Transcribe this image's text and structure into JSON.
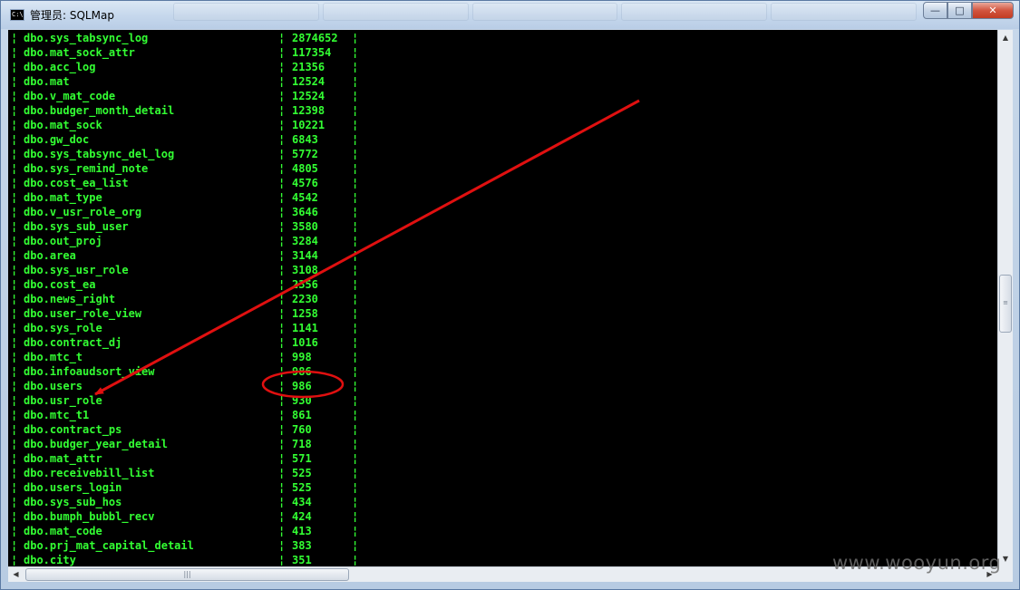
{
  "window": {
    "title": "管理员: SQLMap",
    "icon_label": "C:\\",
    "minimize_glyph": "—",
    "maximize_glyph": "□",
    "close_glyph": "✕"
  },
  "console": {
    "text_color": "#33ff33",
    "background": "#000000",
    "separator": "¦",
    "rows": [
      {
        "name": "dbo.sys_tabsync_log",
        "count": "2874652"
      },
      {
        "name": "dbo.mat_sock_attr",
        "count": "117354"
      },
      {
        "name": "dbo.acc_log",
        "count": "21356"
      },
      {
        "name": "dbo.mat",
        "count": "12524"
      },
      {
        "name": "dbo.v_mat_code",
        "count": "12524"
      },
      {
        "name": "dbo.budger_month_detail",
        "count": "12398"
      },
      {
        "name": "dbo.mat_sock",
        "count": "10221"
      },
      {
        "name": "dbo.gw_doc",
        "count": "6843"
      },
      {
        "name": "dbo.sys_tabsync_del_log",
        "count": "5772"
      },
      {
        "name": "dbo.sys_remind_note",
        "count": "4805"
      },
      {
        "name": "dbo.cost_ea_list",
        "count": "4576"
      },
      {
        "name": "dbo.mat_type",
        "count": "4542"
      },
      {
        "name": "dbo.v_usr_role_org",
        "count": "3646"
      },
      {
        "name": "dbo.sys_sub_user",
        "count": "3580"
      },
      {
        "name": "dbo.out_proj",
        "count": "3284"
      },
      {
        "name": "dbo.area",
        "count": "3144"
      },
      {
        "name": "dbo.sys_usr_role",
        "count": "3108"
      },
      {
        "name": "dbo.cost_ea",
        "count": "2356"
      },
      {
        "name": "dbo.news_right",
        "count": "2230"
      },
      {
        "name": "dbo.user_role_view",
        "count": "1258"
      },
      {
        "name": "dbo.sys_role",
        "count": "1141"
      },
      {
        "name": "dbo.contract_dj",
        "count": "1016"
      },
      {
        "name": "dbo.mtc_t",
        "count": "998"
      },
      {
        "name": "dbo.infoaudsort_view",
        "count": "986"
      },
      {
        "name": "dbo.users",
        "count": "986"
      },
      {
        "name": "dbo.usr_role",
        "count": "930"
      },
      {
        "name": "dbo.mtc_t1",
        "count": "861"
      },
      {
        "name": "dbo.contract_ps",
        "count": "760"
      },
      {
        "name": "dbo.budger_year_detail",
        "count": "718"
      },
      {
        "name": "dbo.mat_attr",
        "count": "571"
      },
      {
        "name": "dbo.receivebill_list",
        "count": "525"
      },
      {
        "name": "dbo.users_login",
        "count": "525"
      },
      {
        "name": "dbo.sys_sub_hos",
        "count": "434"
      },
      {
        "name": "dbo.bumph_bubbl_recv",
        "count": "424"
      },
      {
        "name": "dbo.mat_code",
        "count": "413"
      },
      {
        "name": "dbo.prj_mat_capital_detail",
        "count": "383"
      },
      {
        "name": "dbo.city",
        "count": "351"
      }
    ]
  },
  "annotation": {
    "color": "#e01010",
    "highlighted_row": "dbo.users"
  },
  "scrollbars": {
    "up_glyph": "▲",
    "down_glyph": "▼",
    "left_glyph": "◀",
    "right_glyph": "▶",
    "grip_glyph": "≡",
    "grip_glyph_h": "|||"
  },
  "watermark": "www.wooyun.org"
}
